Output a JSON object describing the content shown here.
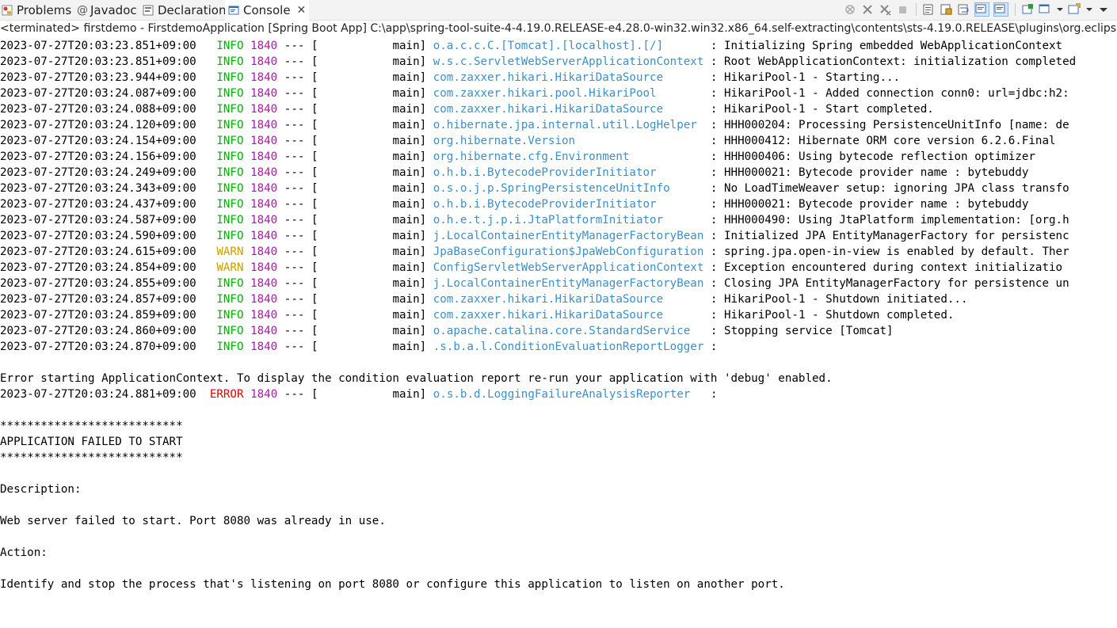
{
  "tabs": [
    {
      "label": "Problems",
      "icon": "problems-icon"
    },
    {
      "label": "Javadoc",
      "icon": "javadoc-icon"
    },
    {
      "label": "Declaration",
      "icon": "declaration-icon"
    },
    {
      "label": "Console",
      "icon": "console-icon",
      "active": true
    }
  ],
  "process_label": "<terminated> firstdemo - FirstdemoApplication [Spring Boot App] C:\\app\\spring-tool-suite-4-4.19.0.RELEASE-e4.28.0-win32.win32.x86_64.self-extracting\\contents\\sts-4.19.0.RELEASE\\plugins\\org.eclipse.justj",
  "log_lines": [
    {
      "ts": "2023-07-27T20:03:23.851+09:00",
      "level": "INFO",
      "pid": "1840",
      "thread": "main",
      "logger": "o.a.c.c.C.[Tomcat].[localhost].[/]",
      "msg": "Initializing Spring embedded WebApplicationContext"
    },
    {
      "ts": "2023-07-27T20:03:23.851+09:00",
      "level": "INFO",
      "pid": "1840",
      "thread": "main",
      "logger": "w.s.c.ServletWebServerApplicationContext",
      "msg": "Root WebApplicationContext: initialization completed"
    },
    {
      "ts": "2023-07-27T20:03:23.944+09:00",
      "level": "INFO",
      "pid": "1840",
      "thread": "main",
      "logger": "com.zaxxer.hikari.HikariDataSource",
      "msg": "HikariPool-1 - Starting..."
    },
    {
      "ts": "2023-07-27T20:03:24.087+09:00",
      "level": "INFO",
      "pid": "1840",
      "thread": "main",
      "logger": "com.zaxxer.hikari.pool.HikariPool",
      "msg": "HikariPool-1 - Added connection conn0: url=jdbc:h2:"
    },
    {
      "ts": "2023-07-27T20:03:24.088+09:00",
      "level": "INFO",
      "pid": "1840",
      "thread": "main",
      "logger": "com.zaxxer.hikari.HikariDataSource",
      "msg": "HikariPool-1 - Start completed."
    },
    {
      "ts": "2023-07-27T20:03:24.120+09:00",
      "level": "INFO",
      "pid": "1840",
      "thread": "main",
      "logger": "o.hibernate.jpa.internal.util.LogHelper",
      "msg": "HHH000204: Processing PersistenceUnitInfo [name: de"
    },
    {
      "ts": "2023-07-27T20:03:24.154+09:00",
      "level": "INFO",
      "pid": "1840",
      "thread": "main",
      "logger": "org.hibernate.Version",
      "msg": "HHH000412: Hibernate ORM core version 6.2.6.Final"
    },
    {
      "ts": "2023-07-27T20:03:24.156+09:00",
      "level": "INFO",
      "pid": "1840",
      "thread": "main",
      "logger": "org.hibernate.cfg.Environment",
      "msg": "HHH000406: Using bytecode reflection optimizer"
    },
    {
      "ts": "2023-07-27T20:03:24.249+09:00",
      "level": "INFO",
      "pid": "1840",
      "thread": "main",
      "logger": "o.h.b.i.BytecodeProviderInitiator",
      "msg": "HHH000021: Bytecode provider name : bytebuddy"
    },
    {
      "ts": "2023-07-27T20:03:24.343+09:00",
      "level": "INFO",
      "pid": "1840",
      "thread": "main",
      "logger": "o.s.o.j.p.SpringPersistenceUnitInfo",
      "msg": "No LoadTimeWeaver setup: ignoring JPA class transfo"
    },
    {
      "ts": "2023-07-27T20:03:24.437+09:00",
      "level": "INFO",
      "pid": "1840",
      "thread": "main",
      "logger": "o.h.b.i.BytecodeProviderInitiator",
      "msg": "HHH000021: Bytecode provider name : bytebuddy"
    },
    {
      "ts": "2023-07-27T20:03:24.587+09:00",
      "level": "INFO",
      "pid": "1840",
      "thread": "main",
      "logger": "o.h.e.t.j.p.i.JtaPlatformInitiator",
      "msg": "HHH000490: Using JtaPlatform implementation: [org.h"
    },
    {
      "ts": "2023-07-27T20:03:24.590+09:00",
      "level": "INFO",
      "pid": "1840",
      "thread": "main",
      "logger": "j.LocalContainerEntityManagerFactoryBean",
      "msg": "Initialized JPA EntityManagerFactory for persistenc"
    },
    {
      "ts": "2023-07-27T20:03:24.615+09:00",
      "level": "WARN",
      "pid": "1840",
      "thread": "main",
      "logger": "JpaBaseConfiguration$JpaWebConfiguration",
      "msg": "spring.jpa.open-in-view is enabled by default. Ther"
    },
    {
      "ts": "2023-07-27T20:03:24.854+09:00",
      "level": "WARN",
      "pid": "1840",
      "thread": "main",
      "logger": "ConfigServletWebServerApplicationContext",
      "msg": "Exception encountered during context initializatio"
    },
    {
      "ts": "2023-07-27T20:03:24.855+09:00",
      "level": "INFO",
      "pid": "1840",
      "thread": "main",
      "logger": "j.LocalContainerEntityManagerFactoryBean",
      "msg": "Closing JPA EntityManagerFactory for persistence un"
    },
    {
      "ts": "2023-07-27T20:03:24.857+09:00",
      "level": "INFO",
      "pid": "1840",
      "thread": "main",
      "logger": "com.zaxxer.hikari.HikariDataSource",
      "msg": "HikariPool-1 - Shutdown initiated..."
    },
    {
      "ts": "2023-07-27T20:03:24.859+09:00",
      "level": "INFO",
      "pid": "1840",
      "thread": "main",
      "logger": "com.zaxxer.hikari.HikariDataSource",
      "msg": "HikariPool-1 - Shutdown completed."
    },
    {
      "ts": "2023-07-27T20:03:24.860+09:00",
      "level": "INFO",
      "pid": "1840",
      "thread": "main",
      "logger": "o.apache.catalina.core.StandardService",
      "msg": "Stopping service [Tomcat]"
    },
    {
      "ts": "2023-07-27T20:03:24.870+09:00",
      "level": "INFO",
      "pid": "1840",
      "thread": "main",
      "logger": ".s.b.a.l.ConditionEvaluationReportLogger",
      "msg": ""
    },
    {
      "text": ""
    },
    {
      "text": "Error starting ApplicationContext. To display the condition evaluation report re-run your application with 'debug' enabled."
    },
    {
      "ts": "2023-07-27T20:03:24.881+09:00",
      "level": "ERROR",
      "pid": "1840",
      "thread": "main",
      "logger": "o.s.b.d.LoggingFailureAnalysisReporter",
      "msg": ""
    },
    {
      "text": ""
    },
    {
      "text": "***************************"
    },
    {
      "text": "APPLICATION FAILED TO START"
    },
    {
      "text": "***************************"
    },
    {
      "text": ""
    },
    {
      "text": "Description:"
    },
    {
      "text": ""
    },
    {
      "text": "Web server failed to start. Port 8080 was already in use."
    },
    {
      "text": ""
    },
    {
      "text": "Action:"
    },
    {
      "text": ""
    },
    {
      "text": "Identify and stop the process that's listening on port 8080 or configure this application to listen on another port."
    }
  ],
  "colors": {
    "info": "#00b000",
    "warn": "#c8a000",
    "error": "#e00000",
    "pid": "#a020a0",
    "logger": "#3c8fc8"
  }
}
